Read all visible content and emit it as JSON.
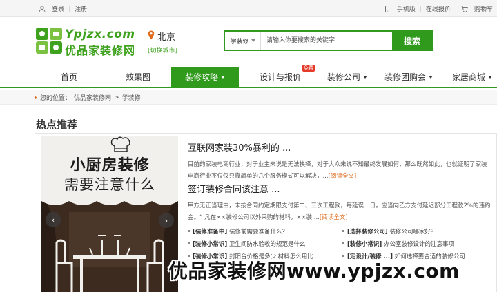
{
  "topbar": {
    "login": "登录",
    "register": "注册",
    "mobile": "手机版",
    "quote": "在线报价",
    "cart": "购物车"
  },
  "header": {
    "logo_en": "Ypjzx.com",
    "logo_cn": "优品家装修网",
    "city": "北京",
    "switch_city": "[切换城市]"
  },
  "search": {
    "category": "学装修",
    "placeholder": "请输入你要搜索的关键字",
    "button": "搜索"
  },
  "nav": {
    "items": [
      {
        "label": "首页"
      },
      {
        "label": "效果图"
      },
      {
        "label": "装修攻略"
      },
      {
        "label": "设计与报价",
        "badge": "免费"
      },
      {
        "label": "装修公司"
      },
      {
        "label": "装修团购会"
      },
      {
        "label": "家居商城"
      }
    ]
  },
  "breadcrumb": {
    "prefix": "您的位置：",
    "home": "优品家装修网",
    "sep": ">",
    "current": "学装修"
  },
  "section": {
    "title": "热点推荐"
  },
  "banner": {
    "line1": "小厨房装修",
    "line2": "需要注意什么",
    "prev": "‹",
    "next": "›"
  },
  "articles": [
    {
      "title": "互联网家装30%暴利的 ...",
      "summary": "目前的家装电商行业，对于业主来说是无法抉择，对于大众来说不知最终发展如何，那么既然如此，也就证明了家装电商行业不仅仅只靠简单的几个服务模式可以解决，...",
      "more": "[阅读全文]"
    },
    {
      "title": "签订装修合同该注意 ...",
      "summary": "甲方无正当理由，未按合同约定期限支付第二、三次工程款，每延误一日，应当向乙方支付延迟部分工程款2%的违约金。“ 凡在××装修公司以外采购的材料，××装 ...",
      "more": "[阅读全文]"
    }
  ],
  "links": [
    {
      "tag": "[装修准备中]",
      "text": "装修前需要准备什么？"
    },
    {
      "tag": "[选择装修公司]",
      "text": "装修公司哪家好？"
    },
    {
      "tag": "[装修小常识]",
      "text": "卫生间防水验收的规范是什么"
    },
    {
      "tag": "[装修小常识]",
      "text": "办公室装修设计的注意事项"
    },
    {
      "tag": "[装修小常识]",
      "text": "封阳台价格是多少 材料怎么用比 ..."
    },
    {
      "tag": "[定设计/装修 ...]",
      "text": "如何选择要合适的装修公司"
    }
  ],
  "watermark": "优品家装修网www.ypjzx.com",
  "colors": {
    "brand_green": "#2f9a1b",
    "accent_orange": "#e06a1a",
    "badge_red": "#e43b2b"
  }
}
